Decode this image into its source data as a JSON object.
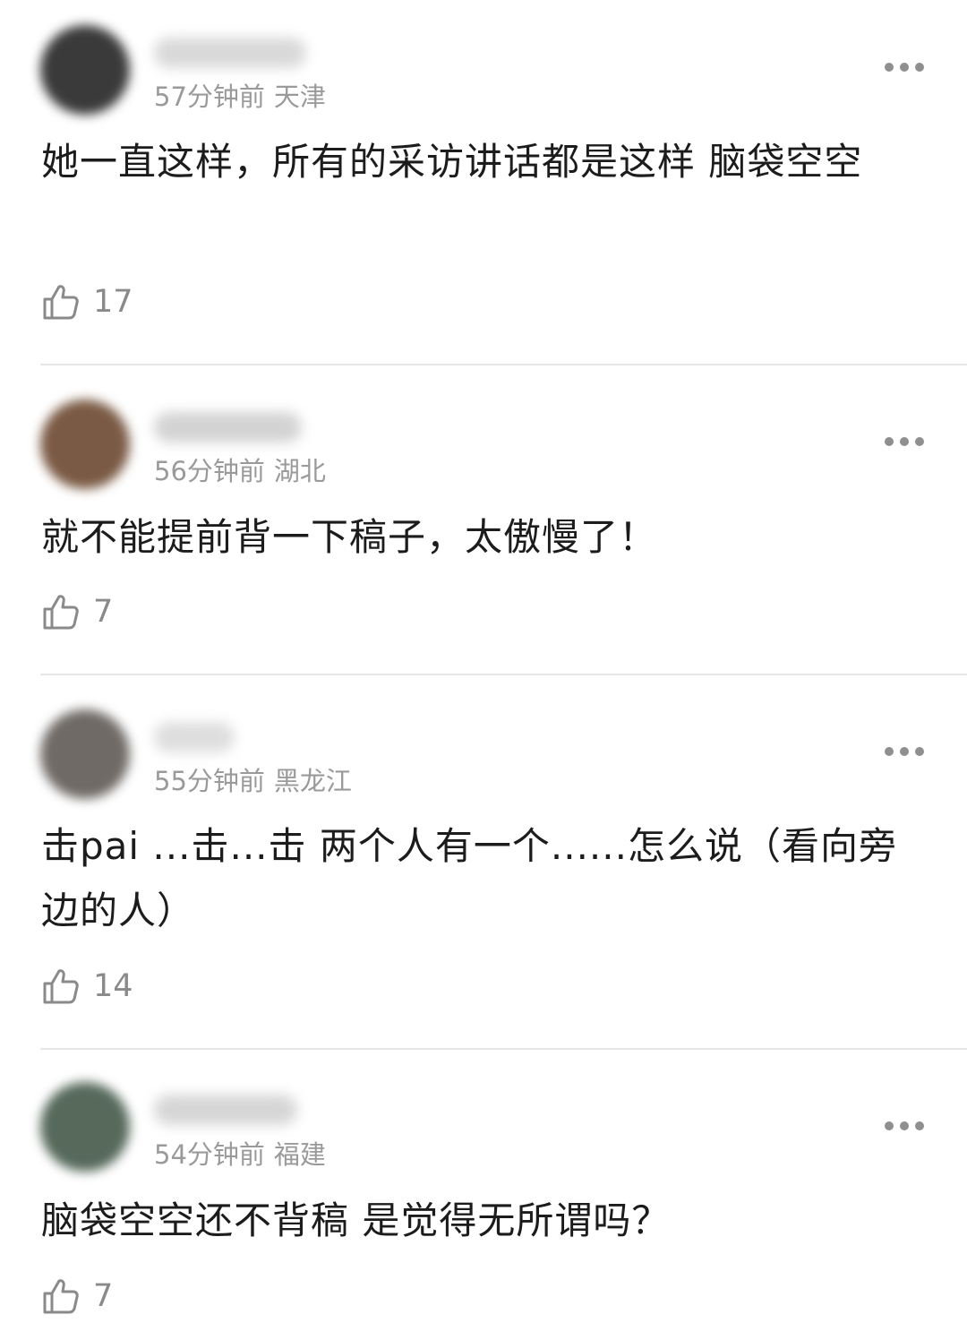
{
  "comments": [
    {
      "time": "57分钟前",
      "location": "天津",
      "text": "她一直这样，所有的采访讲话都是这样 脑袋空空",
      "likes": "17",
      "avatar_color": "#3a3a3a",
      "name_color": "#d9d9d9"
    },
    {
      "time": "56分钟前",
      "location": "湖北",
      "text": "就不能提前背一下稿子，太傲慢了！",
      "likes": "7",
      "avatar_color": "#7a5a44",
      "name_color": "#d3d3d3"
    },
    {
      "time": "55分钟前",
      "location": "黑龙江",
      "text": "击pai ...击...击 两个人有一个......怎么说（看向旁边的人）",
      "likes": "14",
      "avatar_color": "#6f6a66",
      "name_color": "#dedede"
    },
    {
      "time": "54分钟前",
      "location": "福建",
      "text": "脑袋空空还不背稿 是觉得无所谓吗？",
      "likes": "7",
      "avatar_color": "#56695b",
      "name_color": "#d6d6d6"
    }
  ],
  "icons": {
    "like": "thumbs-up-outline-icon",
    "more": "more-horizontal-icon"
  }
}
